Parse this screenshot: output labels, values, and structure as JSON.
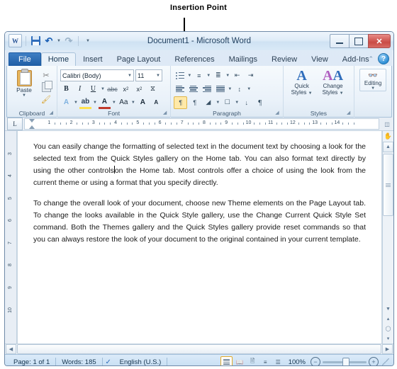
{
  "annotation": {
    "label": "Insertion Point"
  },
  "window": {
    "title": "Document1 - Microsoft Word",
    "quick_access": [
      {
        "name": "word-logo",
        "label": "W"
      },
      {
        "name": "save",
        "label": "Save"
      },
      {
        "name": "undo",
        "label": "Undo"
      },
      {
        "name": "redo",
        "label": "Redo"
      },
      {
        "name": "customize-qat",
        "label": "Customize Quick Access Toolbar"
      }
    ],
    "controls": {
      "minimize": "Minimize",
      "maximize": "Maximize",
      "close": "Close"
    }
  },
  "ribbon": {
    "tabs": [
      {
        "label": "File",
        "active": false
      },
      {
        "label": "Home",
        "active": true
      },
      {
        "label": "Insert",
        "active": false
      },
      {
        "label": "Page Layout",
        "active": false
      },
      {
        "label": "References",
        "active": false
      },
      {
        "label": "Mailings",
        "active": false
      },
      {
        "label": "Review",
        "active": false
      },
      {
        "label": "View",
        "active": false
      },
      {
        "label": "Add-Ins",
        "active": false
      }
    ],
    "minimize_ribbon": "⌃",
    "help": "?",
    "groups": {
      "clipboard": {
        "title": "Clipboard",
        "paste_label": "Paste",
        "items": [
          "Cut",
          "Copy",
          "Format Painter"
        ]
      },
      "font": {
        "title": "Font",
        "font_name": "Calibri (Body)",
        "font_size": "11",
        "bold": "B",
        "italic": "I",
        "underline": "U",
        "strikethrough": "abc",
        "subscript": "x",
        "superscript": "x",
        "clear_formatting": "Clear Formatting",
        "text_effects": "A",
        "highlight": "ab",
        "font_color": "A",
        "change_case": "Aa",
        "grow_font": "A",
        "shrink_font": "A"
      },
      "paragraph": {
        "title": "Paragraph",
        "items": [
          "Bullets",
          "Numbering",
          "Multilevel List",
          "Decrease Indent",
          "Increase Indent",
          "Align Left",
          "Center",
          "Align Right",
          "Justify",
          "Line Spacing",
          "Left-to-Right",
          "Right-to-Left",
          "Shading",
          "Borders",
          "Sort",
          "Show/Hide"
        ]
      },
      "styles": {
        "title": "Styles",
        "quick_styles": "Quick\nStyles",
        "quick_styles_l1": "Quick",
        "quick_styles_l2": "Styles",
        "change_styles_l1": "Change",
        "change_styles_l2": "Styles"
      },
      "editing": {
        "title": "Editing",
        "label": "Editing"
      }
    }
  },
  "ruler": {
    "horizontal_numbers": [
      "1",
      "2",
      "3",
      "4",
      "5",
      "6",
      "7",
      "8",
      "9",
      "10",
      "11",
      "12",
      "13",
      "14"
    ],
    "vertical_numbers": [
      "3",
      "4",
      "5",
      "6",
      "7",
      "8",
      "9",
      "10"
    ],
    "tab_selector": "L"
  },
  "document": {
    "paragraph1_a": "You can easily change the formatting of selected text in the document text by choosing a look for the selected text from the Quick Styles gallery on the Home tab. You can also format text directly by using the other controls",
    "paragraph1_b": "on the Home tab. Most controls offer a choice of using the look from the current theme or using a format that you specify directly.",
    "paragraph2": "To change the overall look of your document, choose new Theme elements on the Page Layout tab. To change the looks available in the Quick Style gallery, use the Change Current Quick Style Set command. Both the Themes gallery and the Quick Styles gallery provide reset commands so that you can always restore the look of your document to the original contained in your current template."
  },
  "status_bar": {
    "page": "Page: 1 of 1",
    "words": "Words: 185",
    "proofing": "Spelling and Grammar Check",
    "language": "English (U.S.)",
    "views": [
      "Print Layout",
      "Full Screen Reading",
      "Web Layout",
      "Outline",
      "Draft"
    ],
    "zoom_percent": "100%",
    "zoom_out": "−",
    "zoom_in": "+"
  },
  "colors": {
    "accent_blue": "#2f6dbb",
    "file_tab": "#1d5ba3",
    "close_red": "#c94b45",
    "highlight_gold": "#e0a92a"
  }
}
